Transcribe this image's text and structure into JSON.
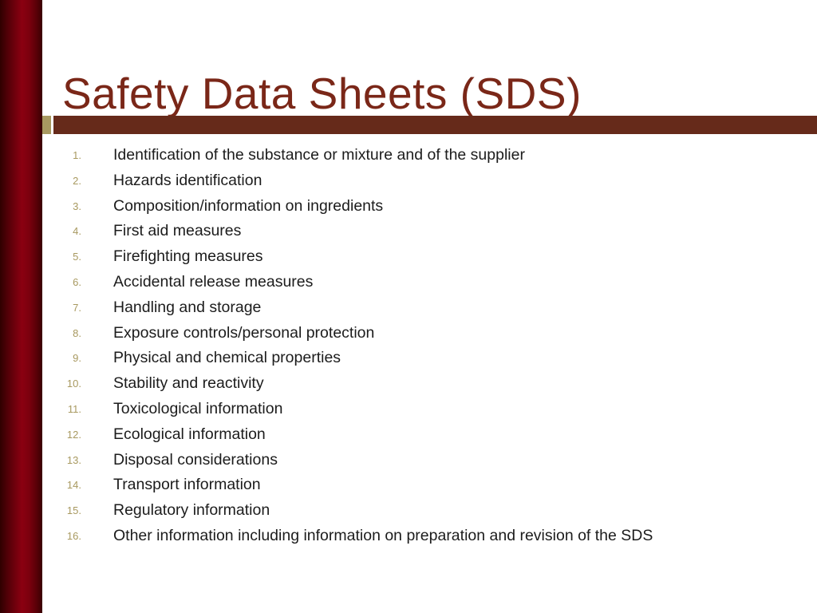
{
  "slide": {
    "title": "Safety Data Sheets (SDS)",
    "colors": {
      "sidebar_dark": "#2e0000",
      "sidebar_bright": "#8a0011",
      "title_text": "#7a2718",
      "accent_bar": "#662a1a",
      "accent_square": "#a89960",
      "number_text": "#a89960",
      "body_text": "#1c1c1c",
      "background": "#ffffff"
    },
    "items": [
      {
        "number": "1.",
        "label": "Identification of the substance or mixture and of the supplier"
      },
      {
        "number": "2.",
        "label": "Hazards identification"
      },
      {
        "number": "3.",
        "label": "Composition/information on ingredients"
      },
      {
        "number": "4.",
        "label": "First aid measures"
      },
      {
        "number": "5.",
        "label": "Firefighting measures"
      },
      {
        "number": "6.",
        "label": "Accidental release measures"
      },
      {
        "number": "7.",
        "label": "Handling and storage"
      },
      {
        "number": "8.",
        "label": "Exposure controls/personal protection"
      },
      {
        "number": "9.",
        "label": "Physical and chemical properties"
      },
      {
        "number": "10.",
        "label": "Stability and reactivity"
      },
      {
        "number": "11.",
        "label": "Toxicological information"
      },
      {
        "number": "12.",
        "label": "Ecological information"
      },
      {
        "number": "13.",
        "label": "Disposal considerations"
      },
      {
        "number": "14.",
        "label": "Transport information"
      },
      {
        "number": "15.",
        "label": "Regulatory information"
      },
      {
        "number": "16.",
        "label": "Other information including information on preparation and revision of the SDS"
      }
    ]
  }
}
